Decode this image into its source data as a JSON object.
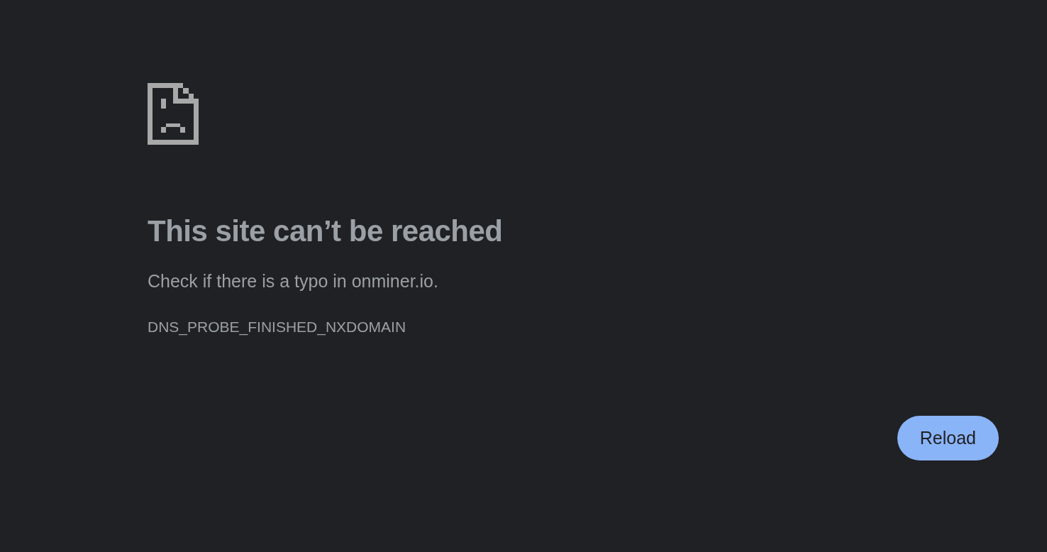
{
  "heading": "This site can’t be reached",
  "message": "Check if there is a typo in onminer.io.",
  "error_code": "DNS_PROBE_FINISHED_NXDOMAIN",
  "buttons": [
    "Reload"
  ]
}
